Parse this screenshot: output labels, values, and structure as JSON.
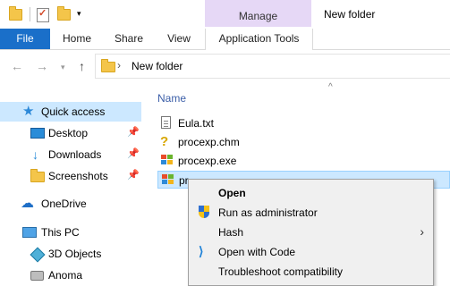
{
  "window": {
    "title": "New folder"
  },
  "ribbon": {
    "context_group": "Manage",
    "tabs": {
      "file": "File",
      "home": "Home",
      "share": "Share",
      "view": "View",
      "application_tools": "Application Tools"
    }
  },
  "address": {
    "path": "New folder"
  },
  "sidebar": {
    "quick_access": "Quick access",
    "items": {
      "desktop": "Desktop",
      "downloads": "Downloads",
      "screenshots": "Screenshots",
      "onedrive": "OneDrive",
      "this_pc": "This PC",
      "objects3d": "3D Objects",
      "anoma": "Anoma"
    }
  },
  "content": {
    "column_name": "Name",
    "files": {
      "eula": "Eula.txt",
      "procexp_chm": "procexp.chm",
      "procexp_exe": "procexp.exe",
      "procexp64_partial": "pr"
    }
  },
  "context_menu": {
    "open": "Open",
    "run_as_admin": "Run as administrator",
    "hash": "Hash",
    "open_with_code": "Open with Code",
    "troubleshoot": "Troubleshoot compatibility"
  },
  "colors": {
    "file_tab": "#1a6fc9",
    "manage_tab": "#e6d8f6",
    "selection": "#cce8ff",
    "menu_bg": "#f0f0f0"
  }
}
